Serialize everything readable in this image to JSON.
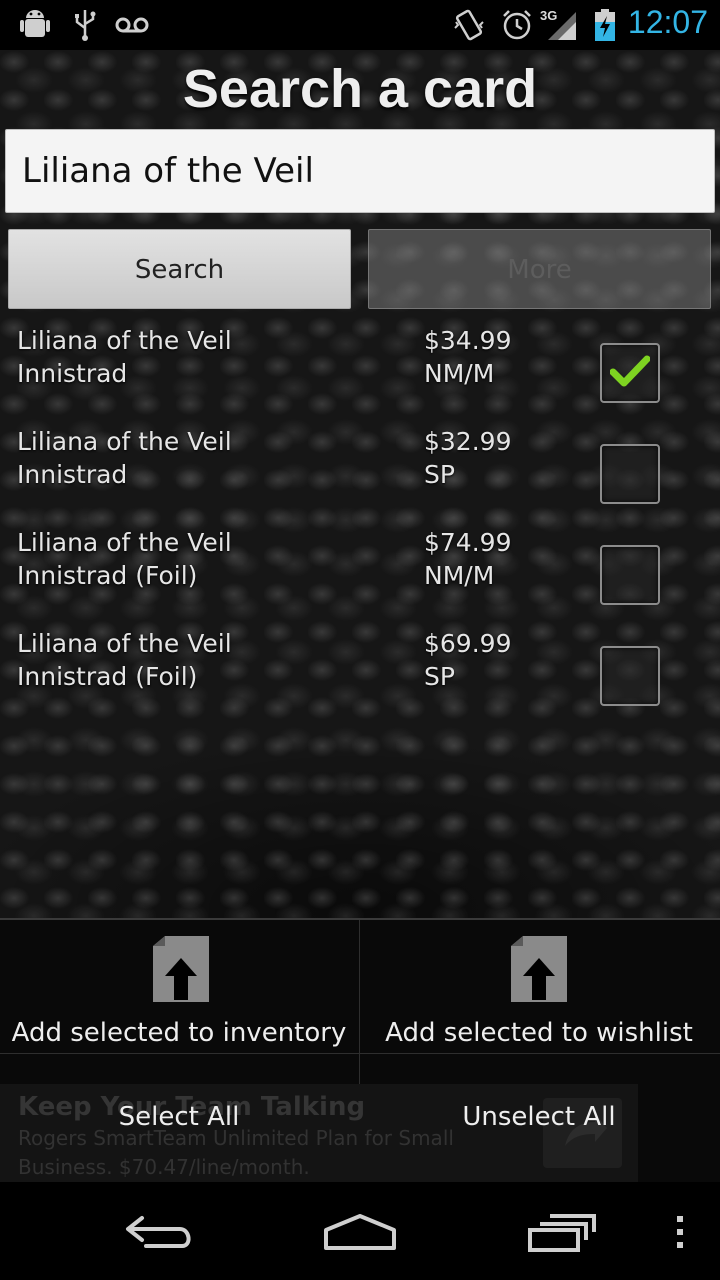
{
  "status_bar": {
    "left_icons": [
      "android-debug-icon",
      "usb-icon",
      "voicemail-icon"
    ],
    "right_icons": [
      "vibrate-icon",
      "alarm-icon",
      "signal-3g-icon",
      "battery-charging-icon"
    ],
    "network": "3G",
    "time": "12:07"
  },
  "page": {
    "title": "Search a card"
  },
  "search": {
    "value": "Liliana of the Veil",
    "search_button": "Search",
    "more_button": "More"
  },
  "results": [
    {
      "name": "Liliana of the Veil",
      "set": "Innistrad",
      "price": "$34.99",
      "condition": "NM/M",
      "checked": true
    },
    {
      "name": "Liliana of the Veil",
      "set": "Innistrad",
      "price": "$32.99",
      "condition": "SP",
      "checked": false
    },
    {
      "name": "Liliana of the Veil",
      "set": "Innistrad (Foil)",
      "price": "$74.99",
      "condition": "NM/M",
      "checked": false
    },
    {
      "name": "Liliana of the Veil",
      "set": "Innistrad (Foil)",
      "price": "$69.99",
      "condition": "SP",
      "checked": false
    }
  ],
  "actions": {
    "add_inventory": "Add selected to inventory",
    "add_wishlist": "Add selected to wishlist",
    "select_all": "Select All",
    "unselect_all": "Unselect All"
  },
  "ad": {
    "headline": "Keep Your Team Talking",
    "body": "Rogers SmartTeam Unlimited Plan for Small Business. $70.47/line/month."
  },
  "nav_bar": {
    "icons": [
      "back-icon",
      "home-icon",
      "recent-apps-icon",
      "overflow-menu-icon"
    ]
  },
  "colors": {
    "clock": "#33b5e5",
    "checkmark": "#7ed321"
  }
}
